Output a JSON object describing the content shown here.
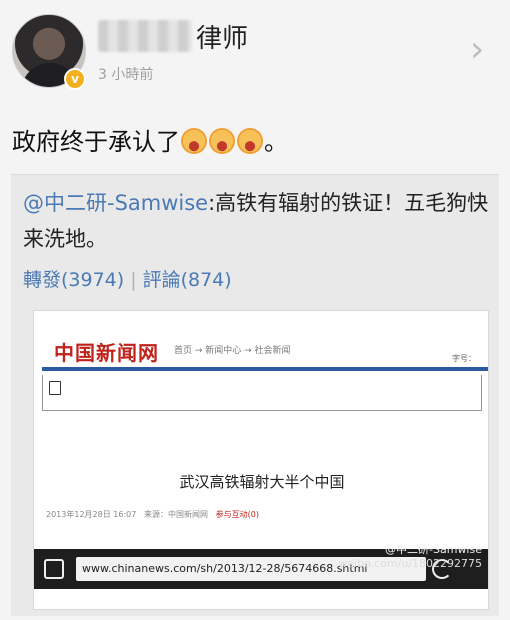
{
  "post": {
    "author_suffix": "律师",
    "time": "3 小時前",
    "text": "政府终于承认了",
    "text_end": "。",
    "emoji_count": 3
  },
  "repost": {
    "mention": "@中二研-Samwise",
    "body": ":高铁有辐射的铁证！五毛狗快来洗地。",
    "reposts_label": "轉發(3974)",
    "comments_label": "評論(874)",
    "separator": "|"
  },
  "embedded": {
    "site_logo": "中国新闻网",
    "breadcrumb": "首页 → 新闻中心 → 社会新闻",
    "label": "字号：",
    "headline": "武汉高铁辐射大半个中国",
    "meta_date": "2013年12月28日 16:07",
    "meta_source": "来源：中国新闻网",
    "meta_participate": "参与互动(0)",
    "url": "www.chinanews.com/sh/2013/12-28/5674668.shtml",
    "watermark_handle": "@中二研-Samwise",
    "watermark_site": "weibo.com/u/1802292775"
  }
}
